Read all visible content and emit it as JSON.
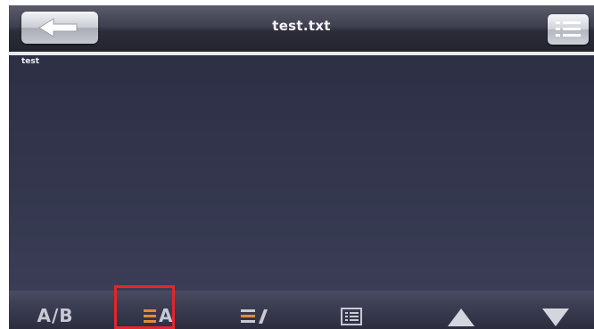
{
  "header": {
    "title": "test.txt",
    "back_icon": "arrow-left-icon",
    "menu_icon": "list-menu-icon"
  },
  "content": {
    "text": "test"
  },
  "toolbar": {
    "ab_label": "A/B",
    "align_label": "A",
    "icons": [
      "ab-toggle-icon",
      "align-text-icon",
      "edit-lines-icon",
      "page-list-icon",
      "arrow-up-icon",
      "arrow-down-icon"
    ]
  },
  "colors": {
    "background": "#2e3148",
    "highlight": "#e3262b",
    "align_accent": "#e38a3a"
  }
}
